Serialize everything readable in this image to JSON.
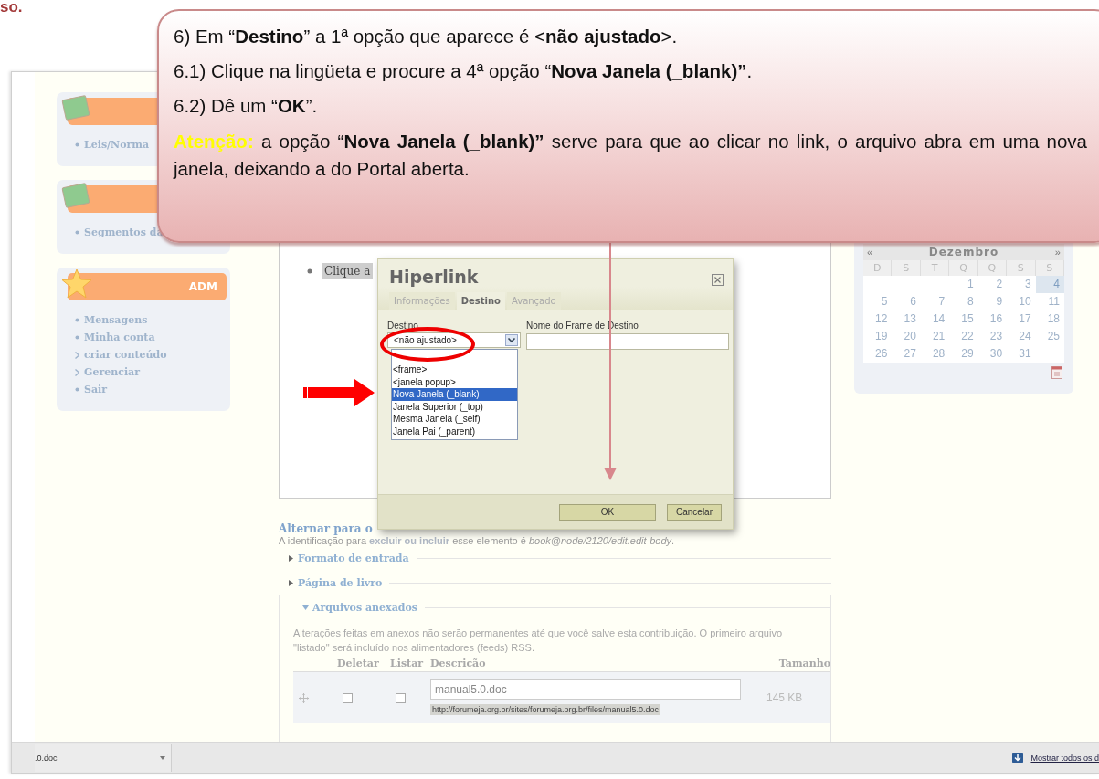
{
  "heading": {
    "text": "so."
  },
  "sidebar": {
    "blocks": [
      {
        "items": [
          {
            "kind": "bullet",
            "text": "Leis/Norma"
          }
        ]
      },
      {
        "items": [
          {
            "kind": "bullet",
            "text": "Segmentos da"
          }
        ]
      },
      {
        "title": "ADM",
        "items": [
          {
            "kind": "bullet",
            "text": "Mensagens"
          },
          {
            "kind": "bullet",
            "text": "Minha conta"
          },
          {
            "kind": "chevron",
            "text": "criar conteúdo"
          },
          {
            "kind": "chevron",
            "text": "Gerenciar"
          },
          {
            "kind": "bullet",
            "text": "Sair"
          }
        ]
      }
    ]
  },
  "editor": {
    "bullet_text": "Clique a"
  },
  "switch_link": "Alternar para o",
  "id_note": "A identificação para **excluir ou incluir** esse elemento é *book@node/2120/edit.edit-body*.",
  "fieldsets": [
    {
      "legend": "Formato de entrada",
      "expanded": false
    },
    {
      "legend": "Página de livro",
      "expanded": false
    },
    {
      "legend": "Arquivos anexados",
      "expanded": true
    }
  ],
  "attachments": {
    "description": "Alterações feitas em anexos não serão permanentes até que você salve esta contribuição. O primeiro arquivo \"listado\" será incluído nos alimentadores (feeds) RSS.",
    "columns": [
      "Deletar",
      "Listar",
      "Descrição",
      "Tamanho"
    ],
    "rows": [
      {
        "delete": false,
        "list": false,
        "description": "manual5.0.doc",
        "url": "http://forumeja.org.br/sites/forumeja.org.br/files/manual5.0.doc",
        "size": "145 KB"
      }
    ]
  },
  "calendar": {
    "prev": "«",
    "month": "Dezembro",
    "next": "»",
    "weekdays": [
      "D",
      "S",
      "T",
      "Q",
      "Q",
      "S",
      "S"
    ],
    "weeks": [
      [
        {
          "day": "1",
          "today": false
        },
        {
          "day": "2",
          "today": false
        },
        {
          "day": "3",
          "today": false
        },
        {
          "day": "4",
          "today": true
        }
      ],
      [
        {
          "day": "5",
          "today": false
        },
        {
          "day": "6",
          "today": false
        },
        {
          "day": "7",
          "today": false
        },
        {
          "day": "8",
          "today": false
        },
        {
          "day": "9",
          "today": false
        },
        {
          "day": "10",
          "today": false
        },
        {
          "day": "11",
          "today": false
        }
      ],
      [
        {
          "day": "12",
          "today": false
        },
        {
          "day": "13",
          "today": false
        },
        {
          "day": "14",
          "today": false
        },
        {
          "day": "15",
          "today": false
        },
        {
          "day": "16",
          "today": false
        },
        {
          "day": "17",
          "today": false
        },
        {
          "day": "18",
          "today": false
        }
      ],
      [
        {
          "day": "19",
          "today": false
        },
        {
          "day": "20",
          "today": false
        },
        {
          "day": "21",
          "today": false
        },
        {
          "day": "22",
          "today": false
        },
        {
          "day": "23",
          "today": false
        },
        {
          "day": "24",
          "today": false
        },
        {
          "day": "25",
          "today": false
        }
      ],
      [
        {
          "day": "26",
          "today": false
        },
        {
          "day": "27",
          "today": false
        },
        {
          "day": "28",
          "today": false
        },
        {
          "day": "29",
          "today": false
        },
        {
          "day": "30",
          "today": false
        },
        {
          "day": "31",
          "today": false
        }
      ]
    ]
  },
  "download_bar": {
    "file": ".0.doc",
    "show_all": "Mostrar todos os d"
  },
  "dialog": {
    "title": "Hiperlink",
    "tabs": [
      {
        "label": "Informações",
        "selected": false
      },
      {
        "label": "Destino",
        "selected": true
      },
      {
        "label": "Avançado",
        "selected": false
      }
    ],
    "target_label": "Destino",
    "target_value": "<não ajustado>",
    "options": [
      {
        "label": "<frame>",
        "selected": false
      },
      {
        "label": "<janela popup>",
        "selected": false
      },
      {
        "label": "Nova Janela (_blank)",
        "selected": true
      },
      {
        "label": "Janela Superior (_top)",
        "selected": false
      },
      {
        "label": "Mesma Janela (_self)",
        "selected": false
      },
      {
        "label": "Janela Pai (_parent)",
        "selected": false
      }
    ],
    "frame_label": "Nome do Frame de Destino",
    "buttons": [
      "OK",
      "Cancelar"
    ]
  },
  "callout": {
    "lines": [
      "6) Em “**Destino**” a 1ª opção que aparece é <**não ajustado**>.",
      "6.1) Clique na lingüeta e procure a 4ª opção “**Nova Janela (_blank)”**.",
      "6.2) Dê um “**OK**”."
    ],
    "warning_label": "Atenção:",
    "warning_text": "a opção “**Nova Janela (_blank)”** serve para que ao clicar no link, o arquivo abra em uma nova janela, deixando a do Portal aberta."
  }
}
